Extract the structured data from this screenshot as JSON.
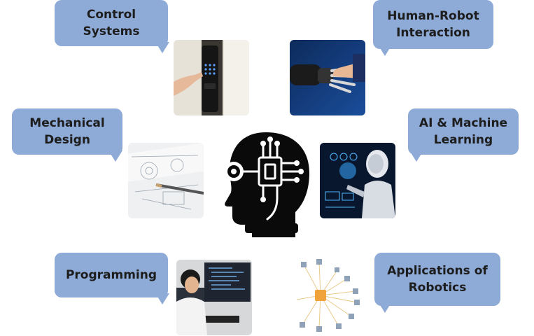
{
  "topics": [
    {
      "label": "Control\nSystems",
      "image": "door-keypad-image"
    },
    {
      "label": "Human-Robot\nInteraction",
      "image": "robot-handshake-image"
    },
    {
      "label": "Mechanical\nDesign",
      "image": "blueprint-image"
    },
    {
      "label": "AI & Machine\nLearning",
      "image": "ai-robot-image"
    },
    {
      "label": "Programming",
      "image": "programmer-image"
    },
    {
      "label": "Applications of\nRobotics",
      "image": "robot-network-image"
    }
  ],
  "center_icon": "robot-head-chip-icon",
  "colors": {
    "bubble": "#8eaad6",
    "text": "#1d1d1d",
    "icon": "#0a0a0a"
  }
}
